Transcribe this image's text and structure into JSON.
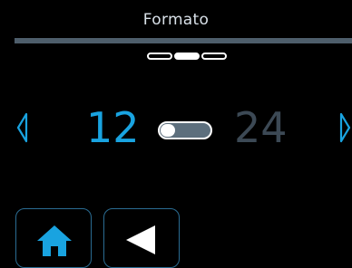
{
  "header": {
    "title": "Formato"
  },
  "pager": {
    "pages": 3,
    "active": 1
  },
  "format": {
    "option_left": "12",
    "option_right": "24",
    "selected": "12"
  },
  "colors": {
    "accent": "#19a3e0",
    "inactive_text": "#3c4955",
    "bar": "#4e5e6b",
    "button_border": "#2a6c92"
  },
  "icons": {
    "prev": "chevron-left-icon",
    "next": "chevron-right-icon",
    "home": "home-icon",
    "back": "back-triangle-icon"
  }
}
